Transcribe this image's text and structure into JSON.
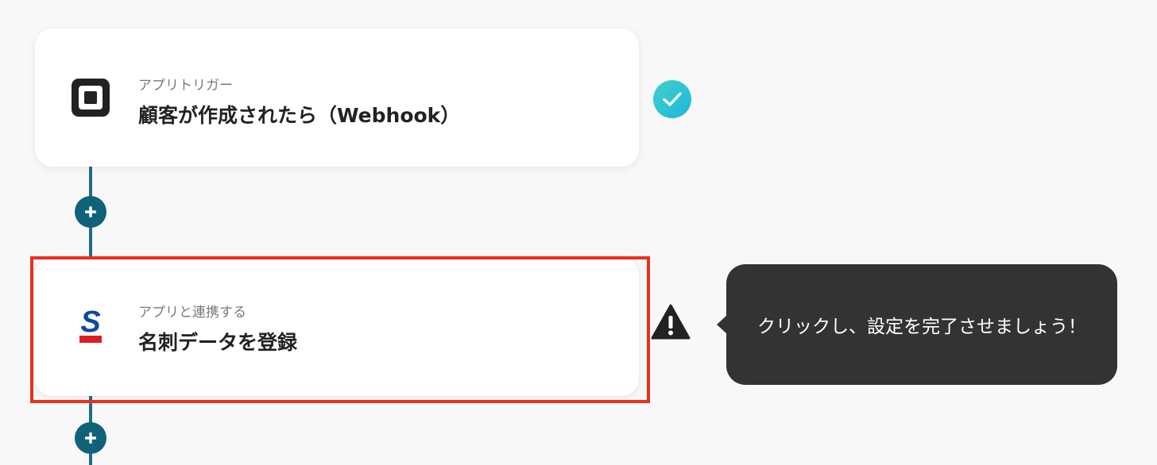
{
  "flow": {
    "trigger": {
      "subtitle": "アプリトリガー",
      "title": "顧客が作成されたら（Webhook）",
      "icon": "square-logo-icon",
      "status": "complete-check-icon",
      "status_color": "#29c2d8"
    },
    "action": {
      "subtitle": "アプリと連携する",
      "title": "名刺データを登録",
      "icon": "sansan-logo-icon",
      "status": "warning-icon",
      "highlight_color": "#e8301f"
    },
    "add_step_icon": "plus-icon",
    "connector_color": "#1f6e86"
  },
  "tooltip": {
    "text": "クリックし、設定を完了させましょう！"
  }
}
